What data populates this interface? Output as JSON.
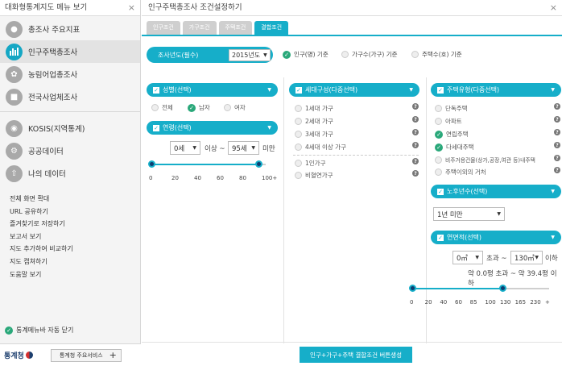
{
  "sidebar": {
    "title": "대화형통계지도 메뉴 보기",
    "close": "×",
    "menu": [
      {
        "label": "총조사 주요지표",
        "icon": "people-icon"
      },
      {
        "label": "인구주택총조사",
        "icon": "bar-chart-icon"
      },
      {
        "label": "농림어업총조사",
        "icon": "leaf-icon"
      },
      {
        "label": "전국사업체조사",
        "icon": "building-icon"
      },
      {
        "label": "KOSIS(지역통계)",
        "icon": "database-icon"
      },
      {
        "label": "공공데이터",
        "icon": "gear-icon"
      },
      {
        "label": "나의 데이터",
        "icon": "upload-icon"
      }
    ],
    "links": [
      "전체 화면 확대",
      "URL 공유하기",
      "즐겨찾기로 저장하기",
      "보고서 보기",
      "지도 추가하여 비교하기",
      "지도 캡쳐하기",
      "도움말 보기"
    ],
    "auto_close": "통계메뉴바 자동 닫기",
    "logo": "통계청",
    "service_button": "통계청 주요서비스",
    "service_plus": "+"
  },
  "main": {
    "title": "인구주택총조사 조건설정하기",
    "close": "×",
    "tabs": [
      "인구조건",
      "가구조건",
      "주택조건",
      "결합조건"
    ],
    "active_tab": 3,
    "year_label": "조사년도(필수)",
    "year_value": "2015년도",
    "basis": [
      {
        "label": "인구(명) 기준",
        "selected": true
      },
      {
        "label": "가구수(가구) 기준",
        "selected": false
      },
      {
        "label": "주택수(호) 기준",
        "selected": false
      }
    ],
    "gender": {
      "label": "성별(선택)",
      "options": [
        {
          "label": "전체",
          "selected": false
        },
        {
          "label": "남자",
          "selected": true
        },
        {
          "label": "여자",
          "selected": false
        }
      ]
    },
    "age": {
      "label": "연령(선택)",
      "from": "0세",
      "mid": "이상 ~",
      "to": "95세",
      "end": "미만",
      "range": [
        0,
        95
      ],
      "ticks": [
        "0",
        "20",
        "40",
        "60",
        "80",
        "100+"
      ]
    },
    "household": {
      "label": "세대구성(다중선택)",
      "options": [
        "1세대 가구",
        "2세대 가구",
        "3세대 가구",
        "4세대 이상 가구",
        "1인가구",
        "비혈연가구"
      ]
    },
    "housing_type": {
      "label": "주택유형(다중선택)",
      "options": [
        {
          "label": "단독주택",
          "selected": false
        },
        {
          "label": "아파트",
          "selected": false
        },
        {
          "label": "연립주택",
          "selected": true
        },
        {
          "label": "다세대주택",
          "selected": true
        },
        {
          "label": "비주거용건물(상가,공장,여관 등)내주택",
          "selected": false
        },
        {
          "label": "주택이외의 거처",
          "selected": false
        }
      ]
    },
    "building_age": {
      "label": "노후년수(선택)",
      "value": "1년 미만"
    },
    "floor_area": {
      "label": "연면적(선택)",
      "from": "0㎡",
      "mid": "초과 ~",
      "to": "130㎡",
      "end": "이하",
      "note": "약 0.0평 초과 ~ 약 39.4평 이하",
      "range": [
        0,
        130
      ],
      "ticks": [
        "0",
        "20",
        "40",
        "60",
        "85",
        "100",
        "130",
        "165",
        "230",
        "+"
      ]
    },
    "generate_button": "인구+가구+주택 결합조건 버튼생성"
  },
  "colors": {
    "accent": "#16aec9",
    "check": "#2aa87a",
    "knob": "#0e3c70"
  }
}
